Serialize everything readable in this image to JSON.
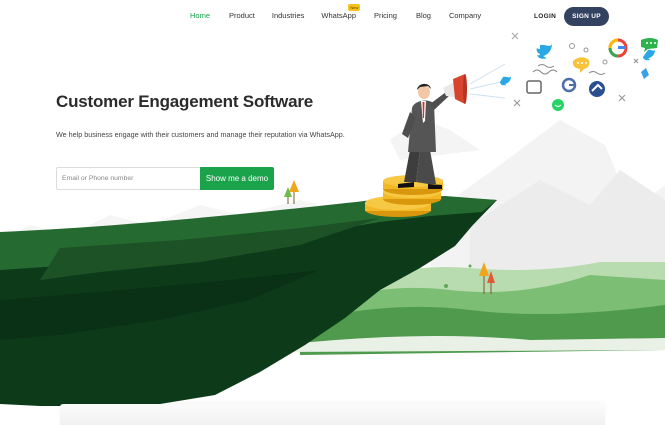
{
  "nav": {
    "links": [
      "Home",
      "Product",
      "Industries",
      "WhatsApp",
      "Pricing",
      "Blog",
      "Company"
    ],
    "badge": "New",
    "login": "LOGIN",
    "signup": "SIGN UP"
  },
  "hero": {
    "title": "Customer Engagement Software",
    "subtitle": "We help business engage with their customers and manage their reputation via WhatsApp.",
    "input_placeholder": "Email or Phone number",
    "cta": "Show me a demo"
  },
  "colors": {
    "accent": "#1aa34a",
    "signup_bg": "#344261",
    "cliff_dark": "#0d3b1a",
    "cliff_light": "#1f5e2a"
  },
  "social_icons": [
    "twitter-icon",
    "google-icon",
    "chat-bubble-icon",
    "whatsapp-icon",
    "gauge-icon"
  ]
}
